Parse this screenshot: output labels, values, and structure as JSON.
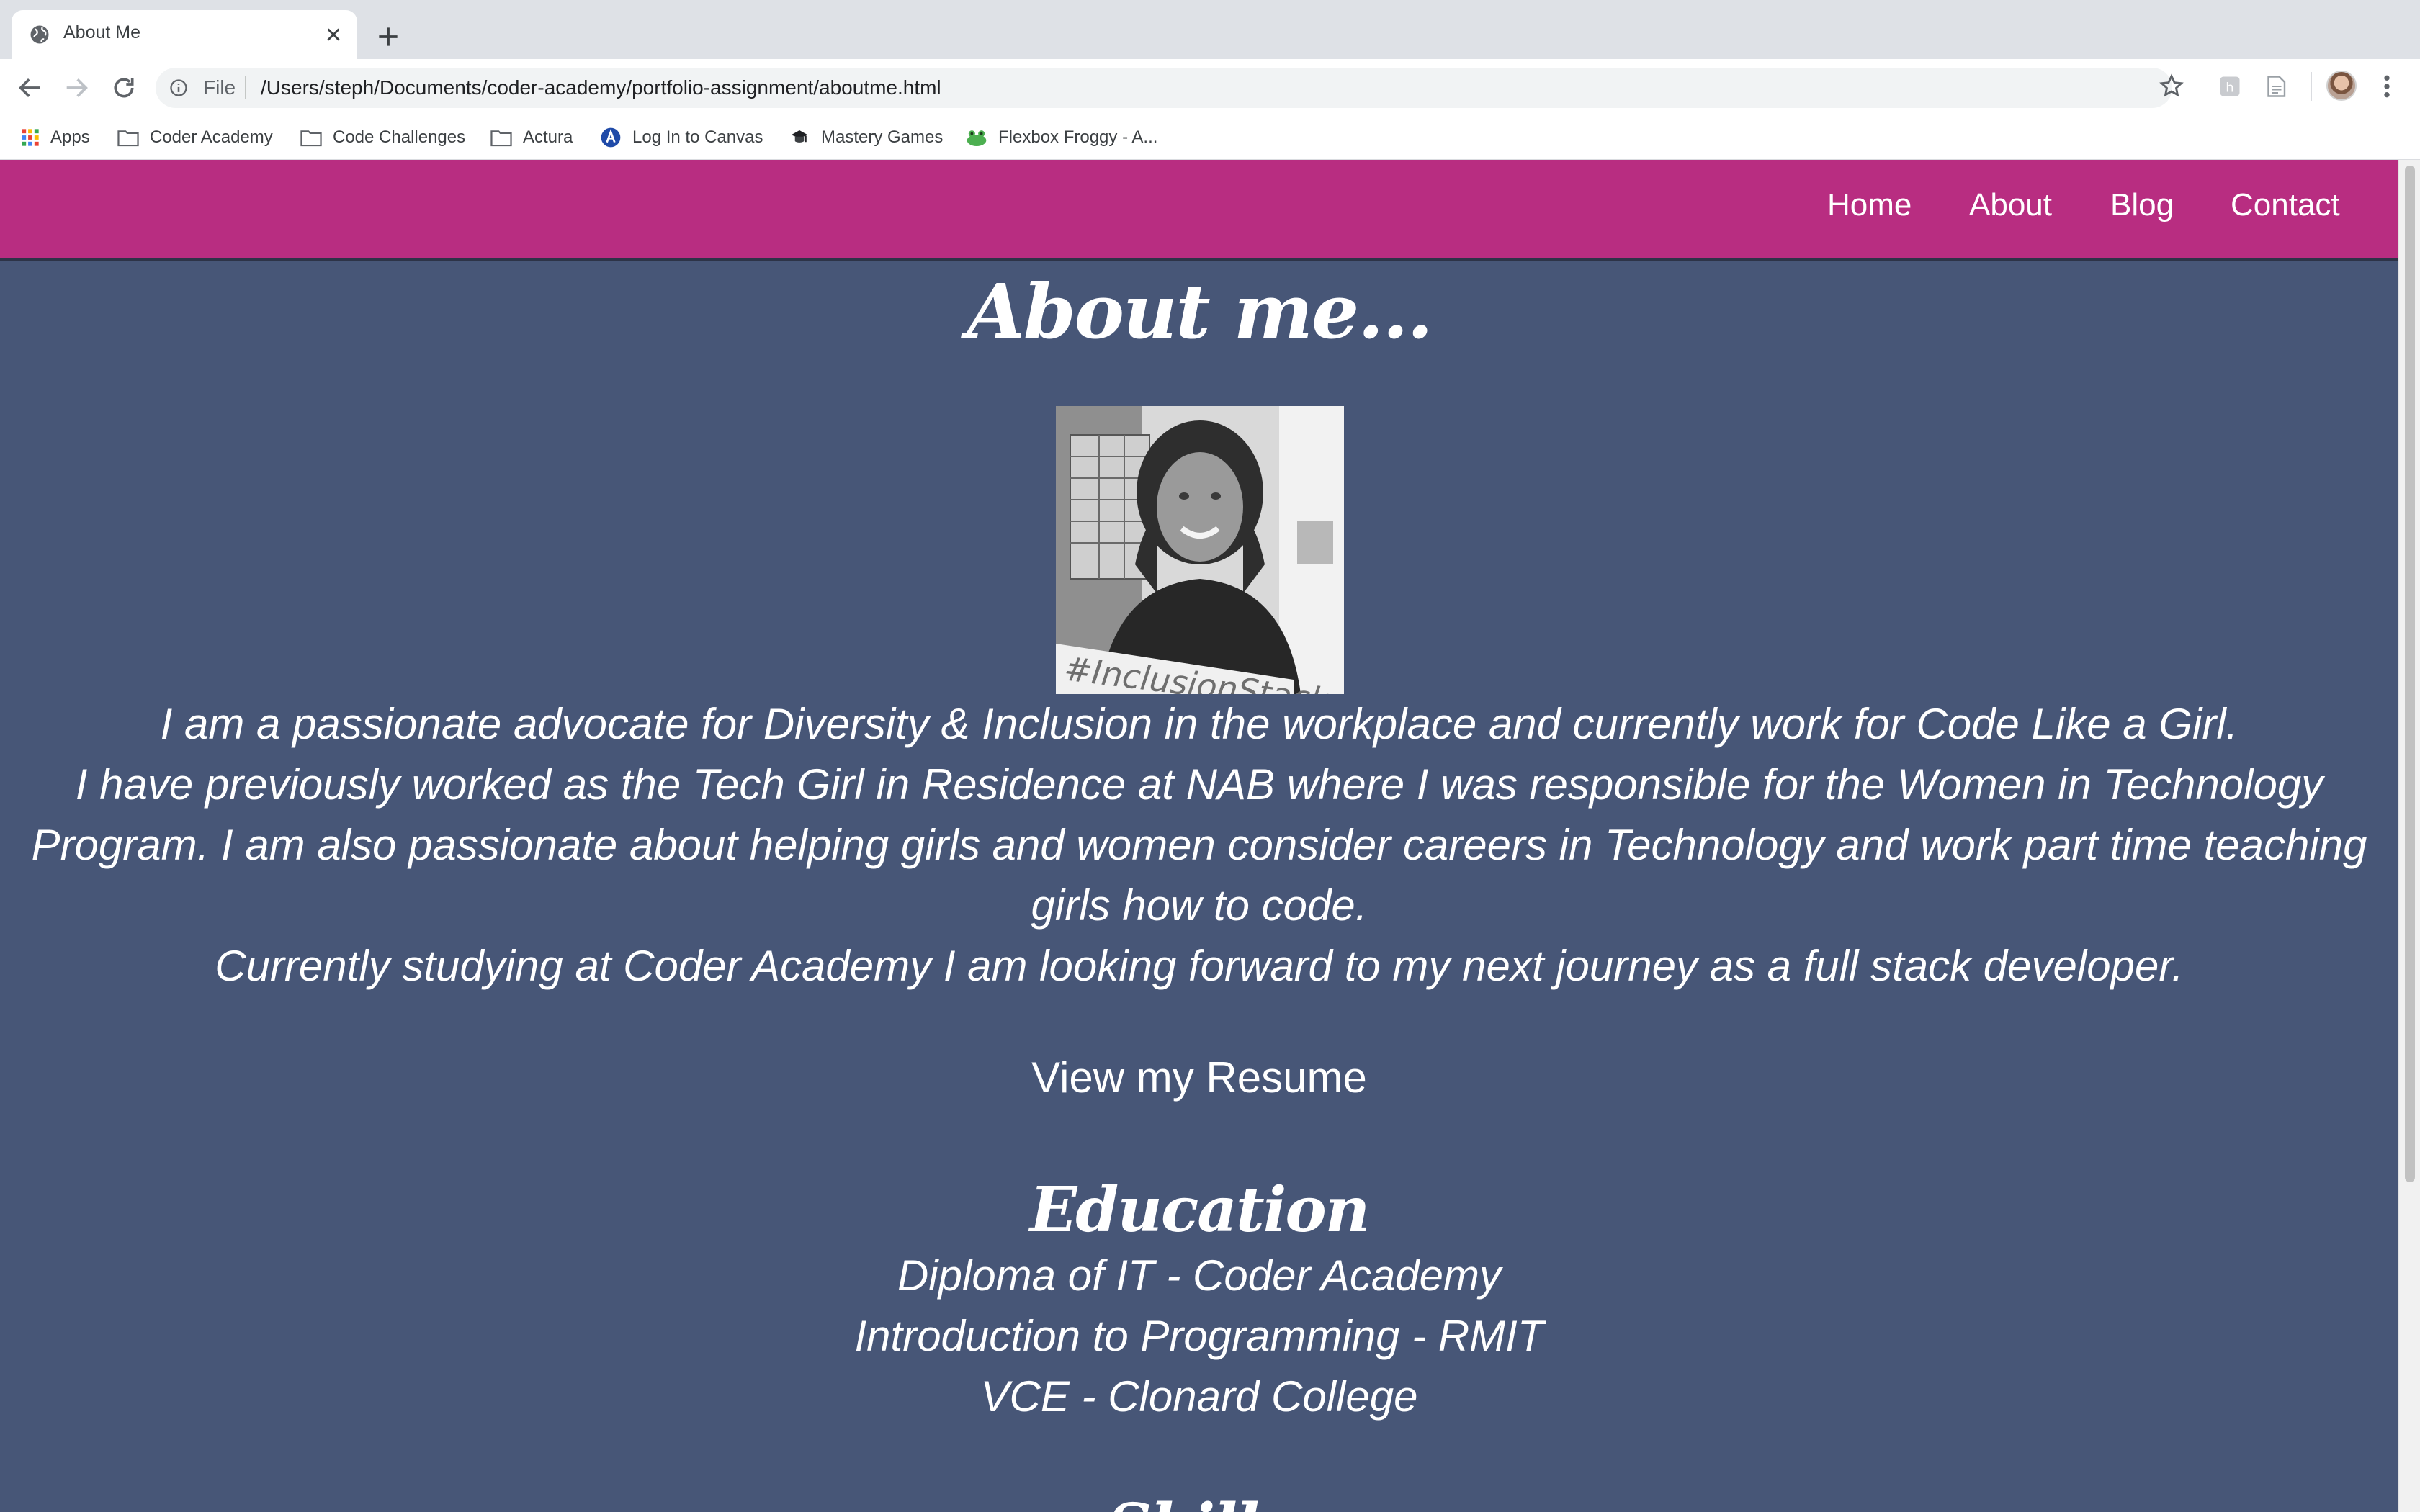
{
  "browser": {
    "tab_title": "About Me",
    "scheme_label": "File",
    "url": "/Users/steph/Documents/coder-academy/portfolio-assignment/aboutme.html",
    "bookmarks": [
      {
        "label": "Apps",
        "icon": "apps-grid-icon"
      },
      {
        "label": "Coder Academy",
        "icon": "folder-icon"
      },
      {
        "label": "Code Challenges",
        "icon": "folder-icon"
      },
      {
        "label": "Actura",
        "icon": "folder-icon"
      },
      {
        "label": "Log In to Canvas",
        "icon": "canvas-icon"
      },
      {
        "label": "Mastery Games",
        "icon": "mastery-games-icon"
      },
      {
        "label": "Flexbox Froggy - A...",
        "icon": "froggy-icon"
      }
    ]
  },
  "site": {
    "nav": [
      {
        "label": "Home"
      },
      {
        "label": "About"
      },
      {
        "label": "Blog"
      },
      {
        "label": "Contact"
      }
    ],
    "heading": "About me...",
    "portrait_sign_text": "#InclusionStack",
    "bio_lines": [
      "I am a passionate advocate for Diversity & Inclusion in the workplace and currently work for Code Like a Girl.",
      "I have previously worked as the Tech Girl in Residence at NAB where I was responsible for the Women in Technology",
      "Program. I am also passionate about helping girls and women consider careers in Technology and work part time teaching",
      "girls how to code.",
      "Currently studying at Coder Academy I am looking forward to my next journey as a full stack developer."
    ],
    "resume_link": "View my Resume",
    "education_heading": "Education",
    "education": [
      "Diploma of IT - Coder Academy",
      "Introduction to Programming - RMIT",
      "VCE - Clonard College"
    ],
    "next_heading": "Skills"
  },
  "colors": {
    "nav_bg": "#b82d81",
    "page_bg": "#475677",
    "text": "#ffffff"
  }
}
